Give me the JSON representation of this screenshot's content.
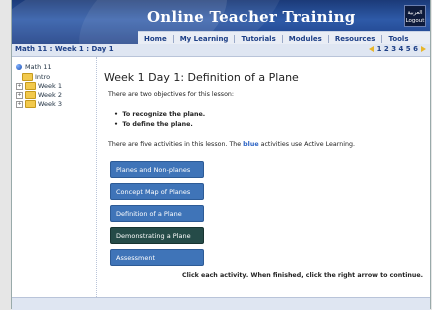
{
  "header": {
    "title": "Online Teacher Training",
    "logout_top": "العربية",
    "logout_bottom": "Logout"
  },
  "nav": {
    "items": [
      "Home",
      "My Learning",
      "Tutorials",
      "Modules",
      "Resources",
      "Tools"
    ]
  },
  "breadcrumb": {
    "text": "Math 11 : Week 1 : Day 1"
  },
  "pager": {
    "pages": "1 2 3 4 5 6"
  },
  "sidebar": {
    "root": "Math 11",
    "items": [
      "Intro",
      "Week 1",
      "Week 2",
      "Week 3"
    ]
  },
  "lesson": {
    "title": "Week 1 Day 1: Definition of a Plane",
    "intro": "There are two objectives for this lesson:",
    "objectives": [
      "To recognize the plane.",
      "To define the plane."
    ],
    "activities_text_before": "There are five activities in this lesson. The ",
    "activities_text_blue": "blue",
    "activities_text_after": " activities use Active Learning.",
    "activities": [
      "Planes and Non-planes",
      "Concept Map of Planes",
      "Definition of a Plane",
      "Demonstrating a Plane",
      "Assessment"
    ],
    "instruction": "Click each activity. When finished, click the right arrow to continue."
  },
  "colors": {
    "accent": "#3f74b8",
    "dark_activity": "#254b48",
    "header": "#1d3f86",
    "pager_arrow": "#e8b62a"
  }
}
